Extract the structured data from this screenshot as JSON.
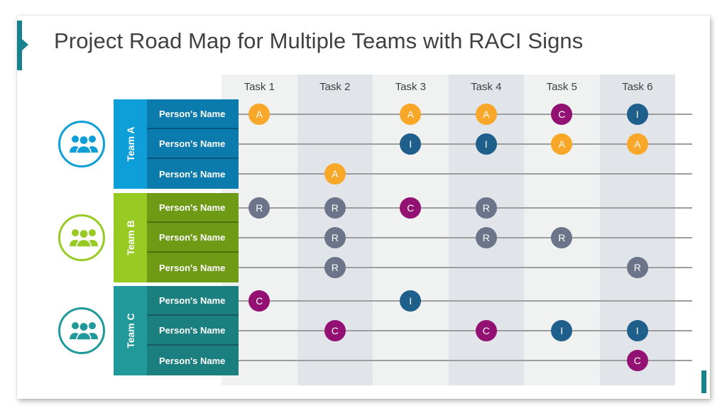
{
  "slide": {
    "title": "Project Road Map for Multiple Teams with RACI Signs",
    "accent_color": "#17828c"
  },
  "columns": [
    {
      "label": "Task 1"
    },
    {
      "label": "Task 2"
    },
    {
      "label": "Task 3"
    },
    {
      "label": "Task 4"
    },
    {
      "label": "Task 5"
    },
    {
      "label": "Task 6"
    }
  ],
  "raci_colors": {
    "A": "#f9a729",
    "R": "#6b7489",
    "C": "#921172",
    "I": "#1f5f8b"
  },
  "teams": [
    {
      "name": "Team A",
      "tab_color": "#0e9fd8",
      "row_color": "#0b7aad",
      "icon_color": "#0e9fd8",
      "people": [
        {
          "name": "Person's Name",
          "marks": [
            "A",
            "",
            "A",
            "A",
            "C",
            "I"
          ]
        },
        {
          "name": "Person's Name",
          "marks": [
            "",
            "",
            "I",
            "I",
            "A",
            "A"
          ]
        },
        {
          "name": "Person's Name",
          "marks": [
            "",
            "A",
            "",
            "",
            "",
            ""
          ]
        }
      ]
    },
    {
      "name": "Team B",
      "tab_color": "#97ca23",
      "row_color": "#6f9a15",
      "icon_color": "#97ca23",
      "people": [
        {
          "name": "Person's Name",
          "marks": [
            "R",
            "R",
            "C",
            "R",
            "",
            ""
          ]
        },
        {
          "name": "Person's Name",
          "marks": [
            "",
            "R",
            "",
            "R",
            "R",
            ""
          ]
        },
        {
          "name": "Person's Name",
          "marks": [
            "",
            "R",
            "",
            "",
            "",
            "R"
          ]
        }
      ]
    },
    {
      "name": "Team C",
      "tab_color": "#21999b",
      "row_color": "#1b7f80",
      "icon_color": "#21999b",
      "people": [
        {
          "name": "Person's Name",
          "marks": [
            "C",
            "",
            "I",
            "",
            "",
            ""
          ]
        },
        {
          "name": "Person's Name",
          "marks": [
            "",
            "C",
            "",
            "C",
            "I",
            "I"
          ]
        },
        {
          "name": "Person's Name",
          "marks": [
            "",
            "",
            "",
            "",
            "",
            "C"
          ]
        }
      ]
    }
  ]
}
